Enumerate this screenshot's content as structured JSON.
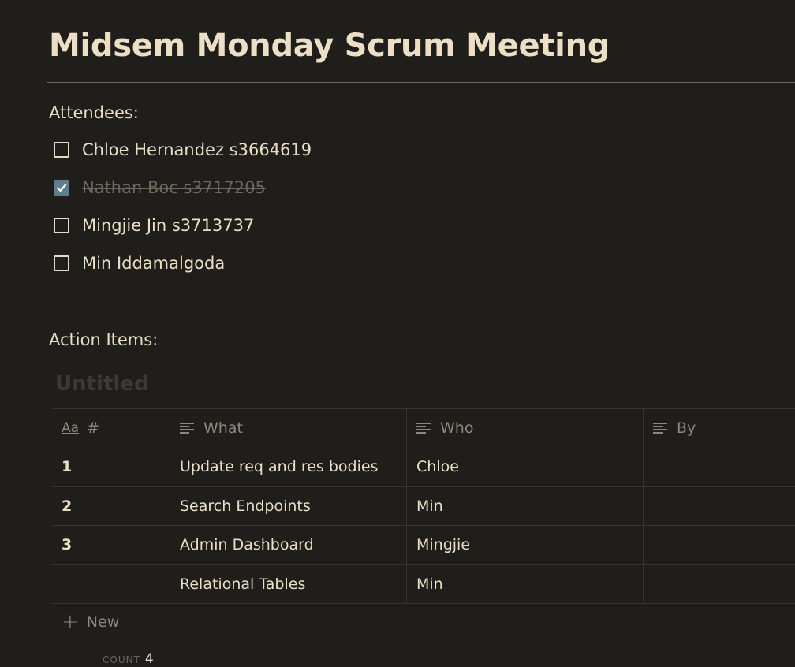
{
  "page": {
    "title": "Midsem Monday Scrum Meeting"
  },
  "attendees": {
    "label": "Attendees:",
    "items": [
      {
        "text": "Chloe Hernandez s3664619",
        "checked": false
      },
      {
        "text": "Nathan Boc s3717205",
        "checked": true
      },
      {
        "text": "Mingjie Jin s3713737",
        "checked": false
      },
      {
        "text": "Min Iddamalgoda",
        "checked": false
      }
    ]
  },
  "action_items": {
    "label": "Action Items:",
    "database_title": "Untitled",
    "columns": [
      {
        "icon": "title-property-icon",
        "prefix": "Aa",
        "label": "#"
      },
      {
        "icon": "text-property-icon",
        "label": "What"
      },
      {
        "icon": "text-property-icon",
        "label": "Who"
      },
      {
        "icon": "text-property-icon",
        "label": "By"
      }
    ],
    "rows": [
      {
        "num": "1",
        "what": "Update req and res bodies",
        "who": "Chloe",
        "by": ""
      },
      {
        "num": "2",
        "what": "Search Endpoints",
        "who": "Min",
        "by": ""
      },
      {
        "num": "3",
        "what": "Admin Dashboard",
        "who": "Mingjie",
        "by": ""
      },
      {
        "num": "",
        "what": "Relational Tables",
        "who": "Min",
        "by": ""
      }
    ],
    "new_label": "New",
    "count_label": "COUNT",
    "count_value": "4"
  },
  "colors": {
    "background": "#1f1e1b",
    "text": "#ebdec6",
    "muted": "#8e877c",
    "checkbox_checked": "#5f7e8c"
  }
}
